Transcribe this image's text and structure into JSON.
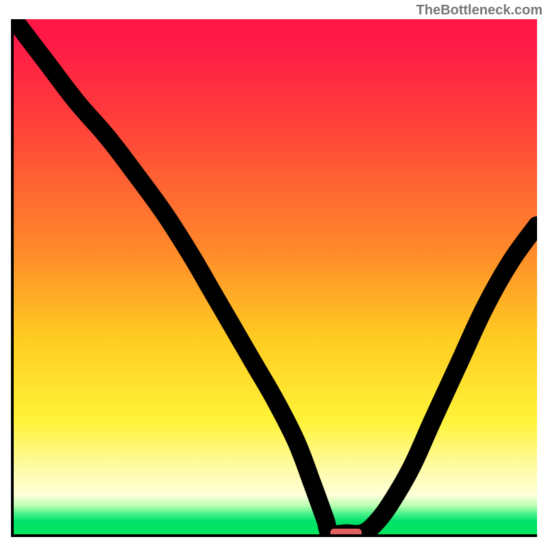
{
  "watermark": "TheBottleneck.com",
  "chart_data": {
    "type": "line",
    "title": "",
    "xlabel": "",
    "ylabel": "",
    "xlim": [
      0,
      100
    ],
    "ylim": [
      0,
      100
    ],
    "x": [
      0,
      6,
      12,
      18,
      24,
      29,
      34,
      38,
      42,
      46,
      50,
      54,
      57,
      59.5,
      61,
      63,
      66,
      69,
      72,
      76,
      80,
      85,
      90,
      95,
      100
    ],
    "values": [
      100,
      92,
      84,
      77,
      69,
      62,
      54,
      47,
      40,
      33,
      26,
      18,
      10,
      3,
      0.3,
      0,
      0.5,
      2,
      6,
      13,
      22,
      33,
      44,
      53,
      60
    ],
    "flat_bottom": {
      "x_start": 60.5,
      "x_end": 66.5,
      "y": 0.2
    },
    "marker": {
      "x_start": 60.5,
      "x_end": 66.5,
      "y": 0.3,
      "color": "#e06060"
    },
    "gradient_bands": [
      {
        "color": "#ff1748",
        "stop_pct": 0
      },
      {
        "color": "#ff8a2a",
        "stop_pct": 45
      },
      {
        "color": "#fff338",
        "stop_pct": 78
      },
      {
        "color": "#fffcaf",
        "stop_pct": 88
      },
      {
        "color": "#00e65b",
        "stop_pct": 100
      }
    ],
    "grid": false,
    "legend": false
  }
}
